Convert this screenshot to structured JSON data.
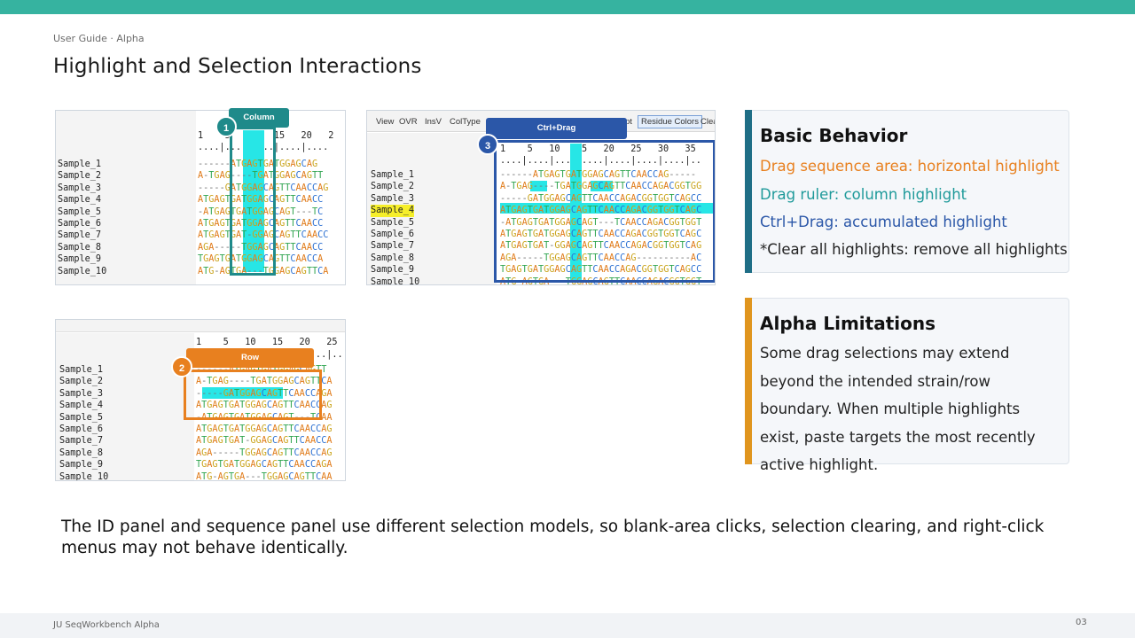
{
  "header": {
    "breadcrumb": "User Guide · Alpha",
    "title": "Highlight and Selection Interactions"
  },
  "colors": {
    "top_bar": "#36b3a0",
    "column_callout": "#1f8a8a",
    "row_callout": "#e8801f",
    "ctrl_callout": "#2b57a8",
    "basic_accent": "#1f6e86",
    "alpha_accent": "#e0951e",
    "highlight_cyan": "#27e6e6",
    "highlight_yellow": "#f6ef2a"
  },
  "screenshots": {
    "column": {
      "callout_label": "Column",
      "callout_number": "1",
      "ruler_numbers": "1    5   10   15   20   2",
      "ruler_ticks": "....|....|....|....|....",
      "sample_ids": [
        "Sample_1",
        "Sample_2",
        "Sample_3",
        "Sample_4",
        "Sample_5",
        "Sample_6",
        "Sample_7",
        "Sample_8",
        "Sample_9",
        "Sample_10"
      ],
      "sequences": [
        "------ATGAGTGATGGAGCAG",
        "A-TGAG----TGATGGAGCAGTT",
        "-----GATGGAGCAGTTCAACCAG",
        "ATGAGTGATGGAGCAGTTCAACC",
        "-ATGAGTGATGGAGCAGT---TC",
        "ATGAGTGATGGAGCAGTTCAACC",
        "ATGAGTGAT-GGAGCAGTTCAACC",
        "AGA-----TGGAGCAGTTCAACC",
        "TGAGTGATGGAGCAGTTCAACCA",
        "ATG-AGTGA---TGGAGCAGTTCA"
      ]
    },
    "row": {
      "callout_label": "Row",
      "callout_number": "2",
      "ruler_numbers": "1    5   10   15   20   25",
      "ruler_ticks": "....|....|....|....|....|..",
      "sample_ids": [
        "Sample_1",
        "Sample_2",
        "Sample_3",
        "Sample_4",
        "Sample_5",
        "Sample_6",
        "Sample_7",
        "Sample_8",
        "Sample_9",
        "Sample_10"
      ],
      "sequences": [
        "------ATGAGTGATGGAGCAGTT",
        "A-TGAG----TGATGGAGCAGTTCA",
        "-----GATGGAGCAGTTCAACCAGA",
        "ATGAGTGATGGAGCAGTTCAACCAG",
        "-ATGAGTGATGGAGCAGT---TCAA",
        "ATGAGTGATGGAGCAGTTCAACCAG",
        "ATGAGTGAT-GGAGCAGTTCAACCA",
        "AGA-----TGGAGCAGTTCAACCAG",
        "TGAGTGATGGAGCAGTTCAACCAGA",
        "ATG-AGTGA---TGGAGCAGTTCAA"
      ]
    },
    "ctrl": {
      "callout_label": "Ctrl+Drag",
      "callout_number": "3",
      "toolbar": {
        "view": "View",
        "ovr": "OVR",
        "insv": "InsV",
        "coltype": "ColType",
        "opt": "pt",
        "residue_colors": "Residue Colors",
        "clear": "Clea"
      },
      "ruler_numbers": "1    5   10   15   20   25   30   35",
      "ruler_ticks": "....|....|....|....|....|....|....|..",
      "sample_ids": [
        "Sample_1",
        "Sample_2",
        "Sample_3",
        "Sample_4",
        "Sample_5",
        "Sample_6",
        "Sample_7",
        "Sample_8",
        "Sample_9",
        "Sample_10"
      ],
      "sequences": [
        "------ATGAGTGATGGAGCAGTTCAACCAG-----",
        "A-TGAG----TGATGGAGCAGTTCAACCAGACGGTGG",
        "-----GATGGAGCAGTTCAACCAGACGGTGGTCAGCC",
        "ATGAGTGATGGAGCAGTTCAACCAGACGGTGGTCAGC",
        "-ATGAGTGATGGAGCAGT---TCAACCAGACGGTGGT",
        "ATGAGTGATGGAGCAGTTCAACCAGACGGTGGTCAGC",
        "ATGAGTGAT-GGAGCAGTTCAACCAGACGGTGGTCAG",
        "AGA-----TGGAGCAGTTCAACCAG----------AC",
        "TGAGTGATGGAGCAGTTCAACCAGACGGTGGTCAGCC",
        "ATG-AGTGA---TGGAGCAGTTCAACCAGACGGTGGT"
      ]
    }
  },
  "cards": {
    "basic": {
      "title": "Basic Behavior",
      "line1": "Drag sequence area: horizontal highlight",
      "line2": "Drag ruler: column highlight",
      "line3": "Ctrl+Drag: accumulated highlight",
      "line4": "*Clear all highlights: remove all highlights",
      "line1_color": "#e8801f",
      "line2_color": "#1f9a9a",
      "line3_color": "#2b57a8"
    },
    "alpha": {
      "title": "Alpha Limitations",
      "body": "Some drag selections may extend beyond the intended strain/row boundary. When multiple highlights exist, paste targets the most recently active highlight."
    }
  },
  "note": "The ID panel and sequence panel use different selection models, so blank-area clicks, selection clearing, and right-click menus may not behave identically.",
  "footer": {
    "left": "JU SeqWorkbench Alpha",
    "page_number": "03"
  }
}
